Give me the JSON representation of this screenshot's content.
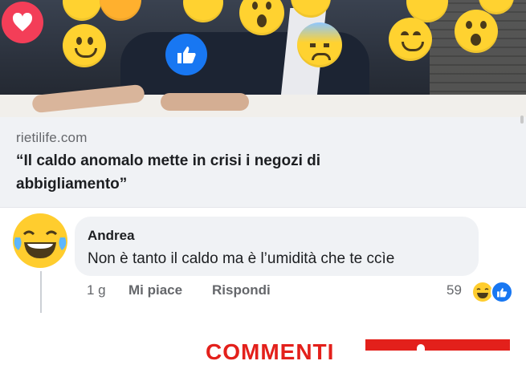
{
  "link_preview": {
    "domain": "rietilife.com",
    "headline": "“Il caldo anomalo mette in crisi i negozi di abbigliamento”"
  },
  "comment": {
    "author": "Andrea",
    "text": "Non è tanto il caldo ma è l’umidità che te ccìe",
    "time": "1 g",
    "like_label": "Mi piace",
    "reply_label": "Rispondi",
    "reaction_count": "59",
    "reaction_icons": [
      "laugh-emoji-icon",
      "like-icon"
    ]
  },
  "banner": {
    "text": "COMMENTI"
  },
  "colors": {
    "facebook_blue": "#1877f2",
    "love_red": "#f33e58",
    "emoji_yellow": "#ffd230",
    "banner_red": "#e3201b",
    "secondary_text": "#65676b"
  }
}
